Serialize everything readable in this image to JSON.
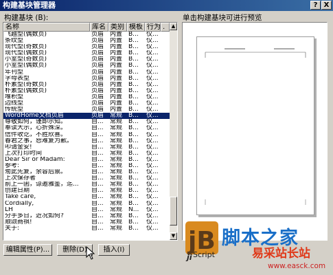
{
  "window": {
    "title": "构建基块管理器",
    "help_btn": "?",
    "close_btn": "X"
  },
  "labels": {
    "list_label": "构建基块 (B):",
    "preview_label": "单击构建基块可进行预览"
  },
  "columns": [
    "名称",
    "库名",
    "类别",
    "模板",
    "行为",
    "."
  ],
  "rows": [
    [
      "飞越型(偶数页)",
      "页眉",
      "内置",
      "B...",
      "仅..."
    ],
    [
      "条纹型",
      "页眉",
      "内置",
      "B...",
      "仅..."
    ],
    [
      "现代型(奇数页)",
      "页眉",
      "内置",
      "B...",
      "仅..."
    ],
    [
      "现代型(偶数页)",
      "页眉",
      "内置",
      "B...",
      "仅..."
    ],
    [
      "小室型(奇数页)",
      "页眉",
      "内置",
      "B...",
      "仅..."
    ],
    [
      "小室型(偶数页)",
      "页眉",
      "内置",
      "B...",
      "仅..."
    ],
    [
      "年刊型",
      "页眉",
      "内置",
      "B...",
      "仅..."
    ],
    [
      "字母表型",
      "页眉",
      "内置",
      "B...",
      "仅..."
    ],
    [
      "朴素型(奇数页)",
      "页眉",
      "内置",
      "B...",
      "仅..."
    ],
    [
      "朴素型(偶数页)",
      "页眉",
      "内置",
      "B...",
      "仅..."
    ],
    [
      "堆积型",
      "页眉",
      "内置",
      "B...",
      "仅..."
    ],
    [
      "边线型",
      "页眉",
      "内置",
      "B...",
      "仅..."
    ],
    [
      "传统型",
      "页眉",
      "内置",
      "B...",
      "仅..."
    ],
    [
      "WordHome文档页眉",
      "页眉",
      "常规",
      "B...",
      "仅..."
    ],
    [
      "尊敬如何，谨即示知。",
      "自...",
      "常规",
      "B...",
      "仅..."
    ],
    [
      "奉读大示，心折殊深。",
      "自...",
      "常规",
      "B...",
      "仅..."
    ],
    [
      "信件收讫，不胜欣喜。",
      "自...",
      "常规",
      "B...",
      "仅..."
    ],
    [
      "春君之事，恕难复为歉。",
      "自...",
      "常规",
      "B...",
      "仅..."
    ],
    [
      "叩请金安!",
      "自...",
      "常规",
      "B...",
      "仅..."
    ],
    [
      "上次打印时间",
      "自...",
      "常规",
      "B...",
      "仅..."
    ],
    [
      "Dear Sir or Madam:",
      "自...",
      "常规",
      "B...",
      "仅..."
    ],
    [
      "参考:",
      "自...",
      "常规",
      "B...",
      "仅..."
    ],
    [
      "匆此先复，余容后禀。",
      "自...",
      "常规",
      "B...",
      "仅..."
    ],
    [
      "上次保存者",
      "自...",
      "常规",
      "B...",
      "仅..."
    ],
    [
      "前上一函，谅邀雅鉴，迄...",
      "自...",
      "常规",
      "B...",
      "仅..."
    ],
    [
      "创建日期",
      "自...",
      "常规",
      "B...",
      "仅..."
    ],
    [
      "Take care,",
      "自...",
      "常规",
      "B...",
      "仅..."
    ],
    [
      "Cordially,",
      "自...",
      "常规",
      "B...",
      "仅..."
    ],
    [
      "LH",
      "自...",
      "常规",
      "N...",
      "仅..."
    ],
    [
      "分手多日，近况如何?",
      "自...",
      "常规",
      "B...",
      "仅..."
    ],
    [
      "顺颂商祺!",
      "自...",
      "常规",
      "B...",
      "仅..."
    ],
    [
      "关于:",
      "自...",
      "常规",
      "B...",
      "仅..."
    ]
  ],
  "selected_row": 13,
  "buttons": {
    "edit": "编辑属性(P)...",
    "delete": "删除(D)",
    "insert": "插入(I)"
  },
  "watermark": {
    "brand": "脚本之家",
    "site": "易采站长站",
    "url": "www.easck.com",
    "script": "Script"
  }
}
